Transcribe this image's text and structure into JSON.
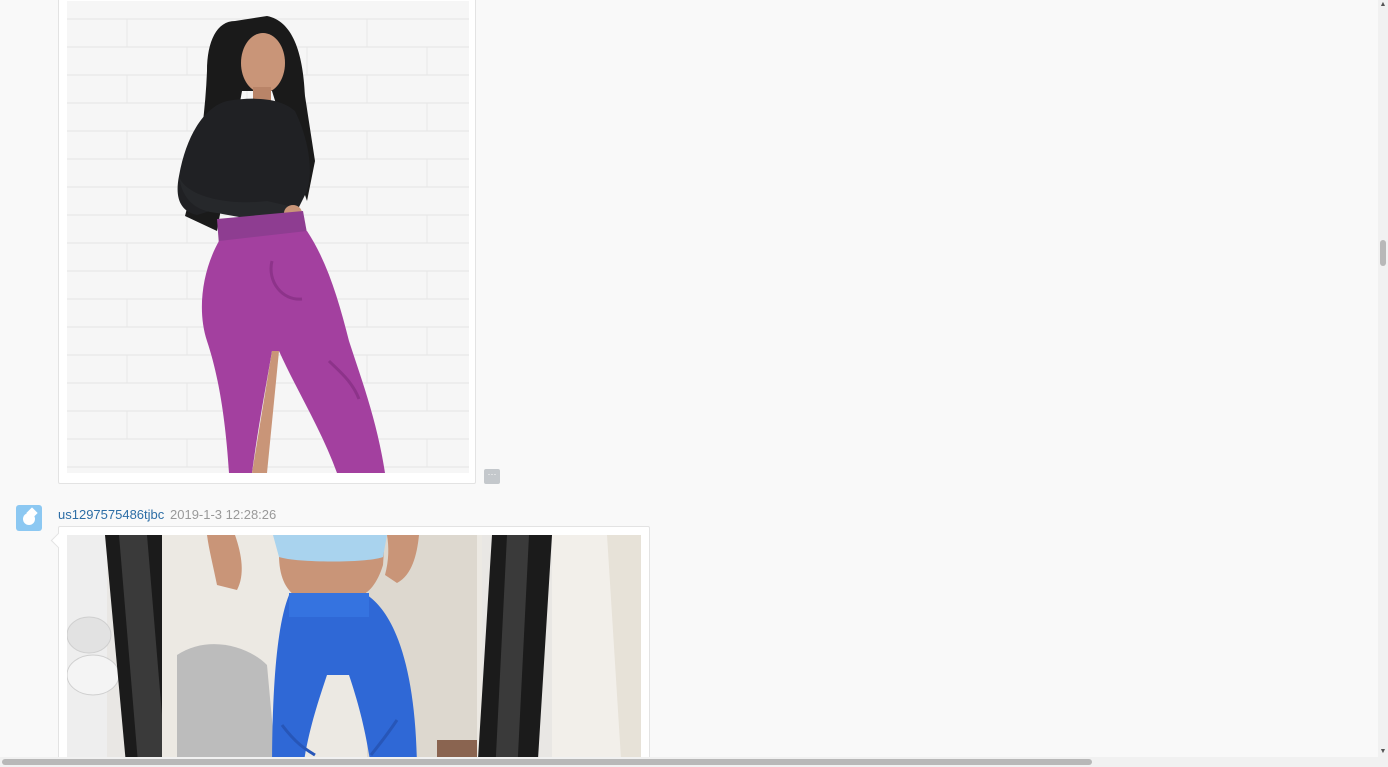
{
  "messages": [
    {
      "image": "woman-purple-leggings-photo"
    },
    {
      "username": "us1297575486tjbc",
      "timestamp": "2019-1-3 12:28:26",
      "image": "woman-blue-leggings-mirror-photo"
    }
  ],
  "more_button": {
    "label": "···"
  },
  "scrollbar": {
    "up_glyph": "▲",
    "down_glyph": "▼"
  },
  "colors": {
    "page_bg": "#f9f9f9",
    "username": "#2d6ea6",
    "timestamp": "#999999",
    "avatar": "#8cc8f2"
  }
}
